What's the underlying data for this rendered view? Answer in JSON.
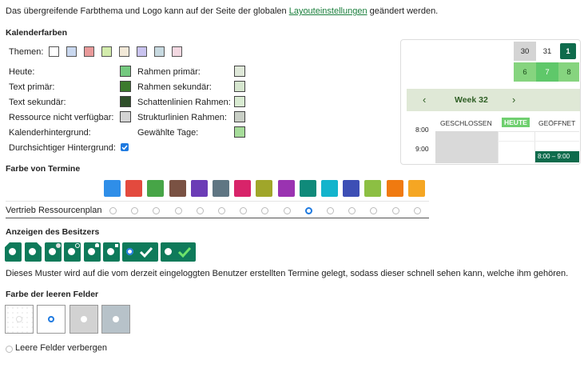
{
  "intro": {
    "text_before": "Das übergreifende Farbthema und Logo kann auf der Seite der globalen",
    "link": "Layouteinstellungen",
    "text_after": "geändert werden."
  },
  "calendar_colors": {
    "title": "Kalenderfarben",
    "themes_label": "Themen:",
    "themes": [
      "#ffffff",
      "#c9d8ef",
      "#e99a9a",
      "#d3ecac",
      "#f2e9d8",
      "#c9c3ef",
      "#c7d9e0",
      "#f3d8e1"
    ],
    "left_labels": [
      "Heute:",
      "Text primär:",
      "Text sekundär:",
      "Ressource nicht verfügbar:",
      "Kalenderhintergrund:",
      "Durchsichtiger Hintergrund:"
    ],
    "left_colors": [
      "#74c97f",
      "#3c7a2c",
      "#2f4f2a",
      "#d4d4d4"
    ],
    "right_labels": [
      "Rahmen primär:",
      "Rahmen sekundär:",
      "Schattenlinien Rahmen:",
      "Strukturlinien Rahmen:",
      "Gewählte Tage:"
    ],
    "right_colors": [
      "#dfe8d9",
      "#d6e6cf",
      "#d9ebd2",
      "#c9cfc6",
      "#a6dc9a"
    ]
  },
  "preview": {
    "dates": [
      "30",
      "31",
      "1",
      "6",
      "7",
      "8"
    ],
    "week_label": "Week 32",
    "times": [
      "8:00",
      "9:00"
    ],
    "col_closed": "GESCHLOSSEN",
    "col_today": "HEUTE",
    "col_open": "GEÖFFNET",
    "event_time": "8:00 – 9:00",
    "icon_prev": "chevron-left-icon",
    "icon_next": "chevron-right-icon"
  },
  "appointment_colors": {
    "title": "Farbe von Termine",
    "colors": [
      "#2f8ee8",
      "#e34a3e",
      "#47a547",
      "#7a5243",
      "#6b3cb6",
      "#5f7683",
      "#d8246a",
      "#a0a62a",
      "#9a33b1",
      "#0f8a7a",
      "#13b4cc",
      "#3d4fb5",
      "#8cbf43",
      "#f07a10",
      "#f5a623"
    ],
    "resource_label": "Vertrieb Ressourcenplan",
    "selected_index": 9
  },
  "owner_display": {
    "title": "Anzeigen des Besitzers",
    "description": "Dieses Muster wird auf die vom derzeit eingeloggten Benutzer erstellten Termine gelegt, sodass dieser schnell sehen kann, welche ihm gehören.",
    "color": "#0e7a5a"
  },
  "empty_fields": {
    "title": "Farbe der leeren Felder",
    "hide_label": "Leere Felder verbergen",
    "colors": [
      "#ffffff",
      "#ffffff",
      "#d2d2d2",
      "#b7c2c9"
    ]
  }
}
